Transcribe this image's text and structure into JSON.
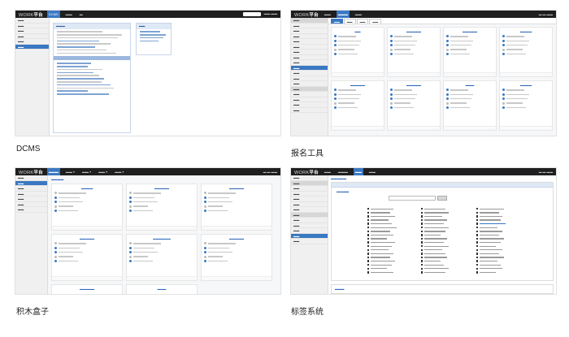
{
  "captions": {
    "p1": "DCMS",
    "p2": "报名工具",
    "p3": "积木盒子",
    "p4": "标签系统"
  },
  "brand": {
    "work_logo_prefix": "WORK",
    "work_logo_suffix": "平台",
    "dcms_label": "DCMS"
  },
  "colors": {
    "topbar": "#1f1f1f",
    "accent": "#3a78c2",
    "sidebar": "#f0f0f0"
  }
}
